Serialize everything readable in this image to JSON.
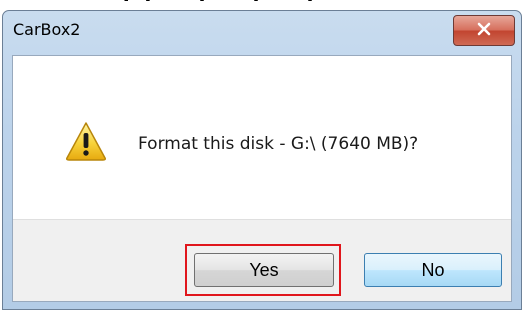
{
  "dialog": {
    "title": "CarBox2",
    "message": "Format this disk - G:\\ (7640 MB)?",
    "icon": "warning-icon",
    "close_glyph": "✕"
  },
  "buttons": {
    "yes_label": "Yes",
    "no_label": "No"
  },
  "colors": {
    "highlight": "#e0161c",
    "close_button": "#c24530",
    "default_button_border": "#3c7fb1"
  }
}
